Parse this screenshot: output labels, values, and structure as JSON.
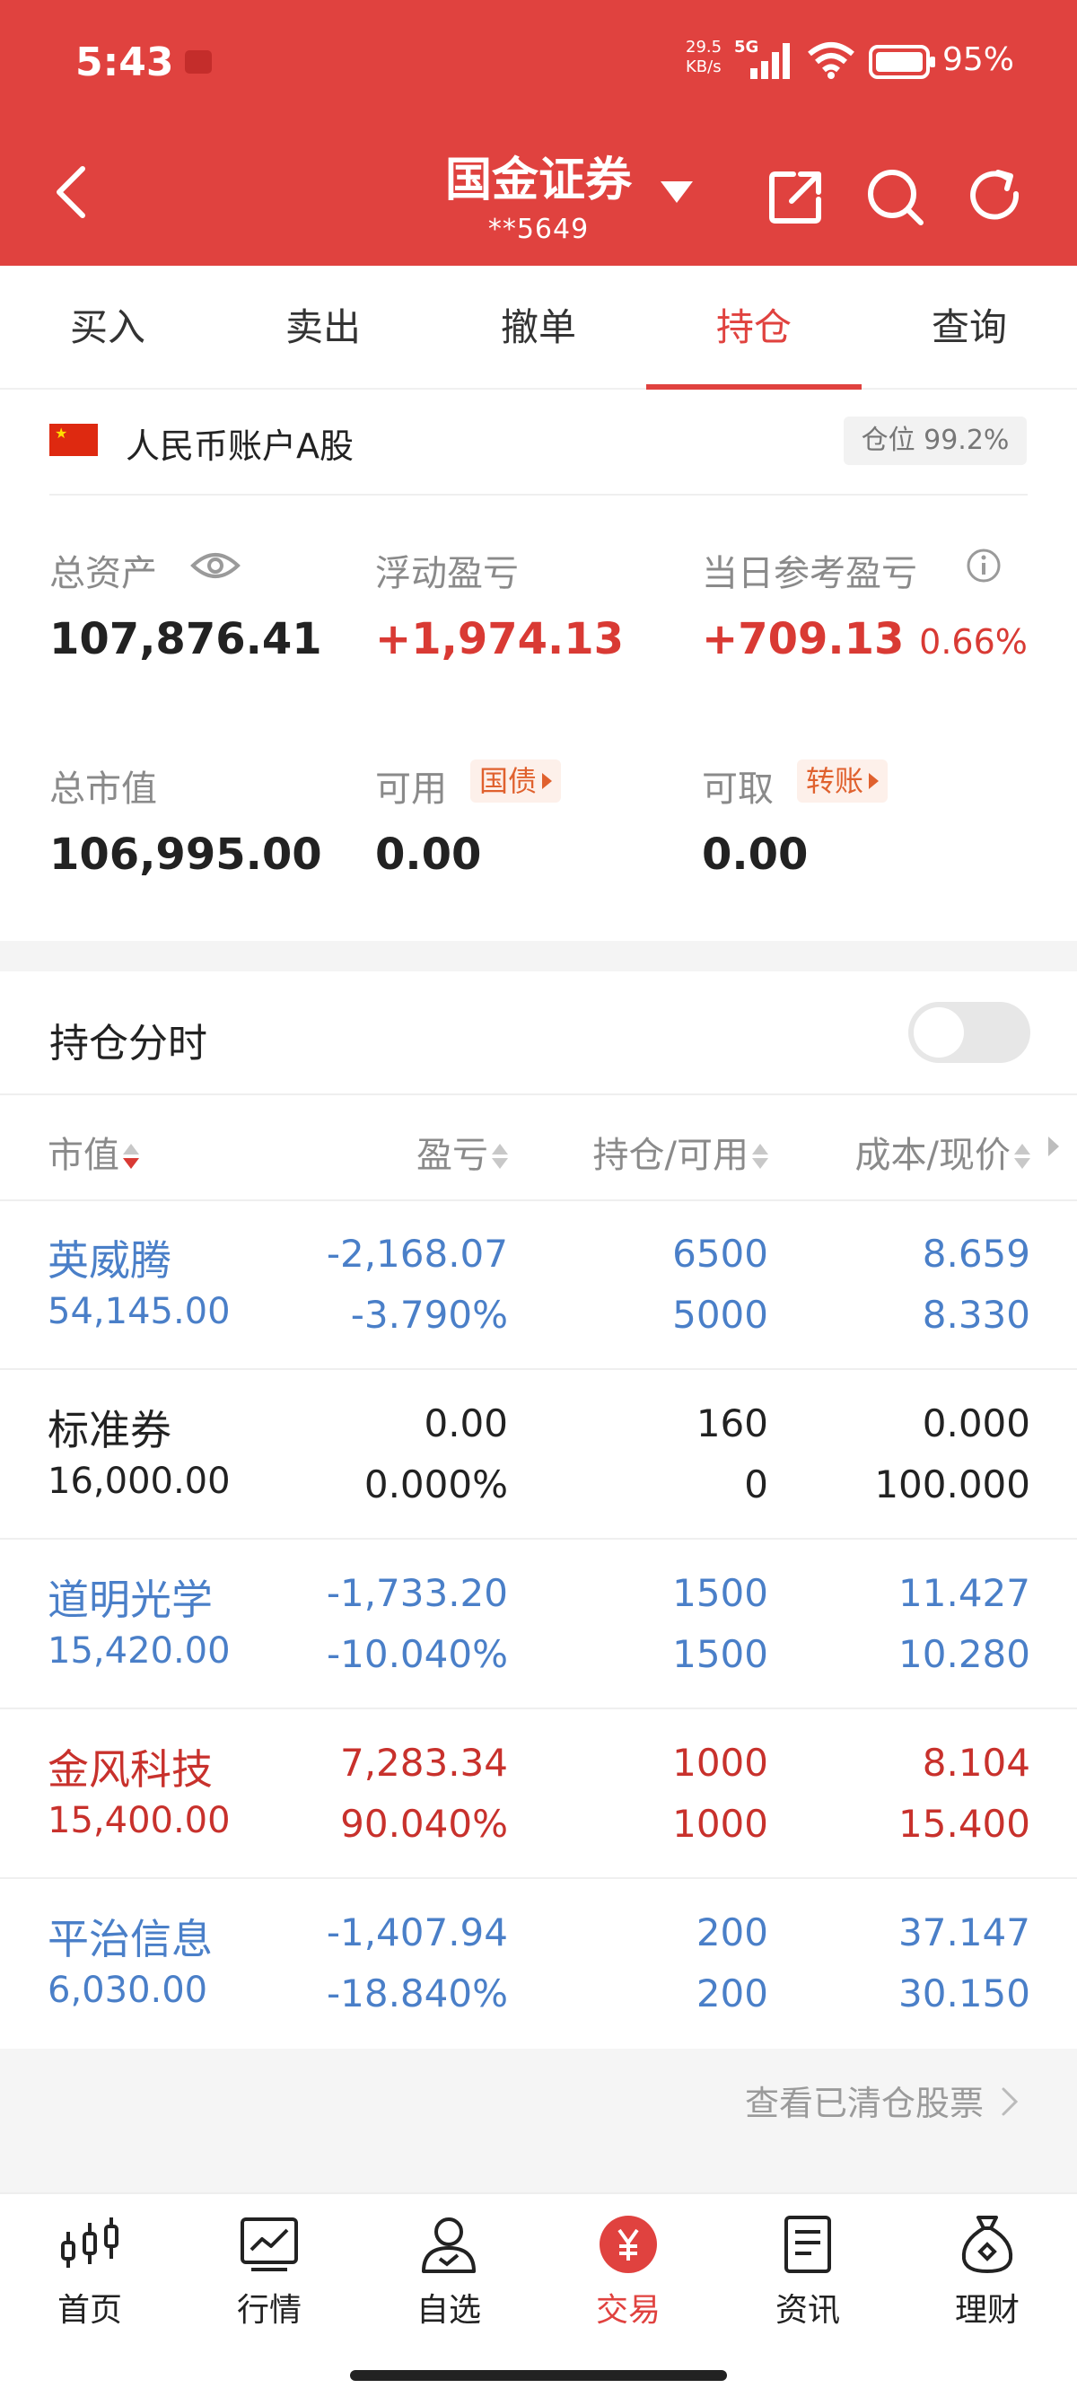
{
  "status": {
    "time": "5:43",
    "net_speed": "29.5\nKB/s",
    "net_speed_top": "29.5",
    "net_speed_bottom": "KB/s",
    "network": "5G",
    "battery": "95%"
  },
  "header": {
    "title": "国金证券",
    "account": "**5649",
    "colors": {
      "brand": "#e0423f"
    }
  },
  "tabs": [
    {
      "label": "买入",
      "active": false
    },
    {
      "label": "卖出",
      "active": false
    },
    {
      "label": "撤单",
      "active": false
    },
    {
      "label": "持仓",
      "active": true
    },
    {
      "label": "查询",
      "active": false
    }
  ],
  "account_summary": {
    "account_name": "人民币账户A股",
    "position_badge": "仓位 99.2%",
    "total_assets_label": "总资产",
    "total_assets": "107,876.41",
    "floating_pl_label": "浮动盈亏",
    "floating_pl": "+1,974.13",
    "daily_pl_label": "当日参考盈亏",
    "daily_pl": "+709.13",
    "daily_pl_pct": "0.66%",
    "market_value_label": "总市值",
    "market_value": "106,995.00",
    "available_label": "可用",
    "available": "0.00",
    "treasury_badge": "国债",
    "withdrawable_label": "可取",
    "withdrawable": "0.00",
    "transfer_badge": "转账"
  },
  "chart_toggle": {
    "label": "持仓分时",
    "enabled": false
  },
  "table": {
    "headers": [
      "市值",
      "盈亏",
      "持仓/可用",
      "成本/现价"
    ],
    "rows": [
      {
        "name": "英威腾",
        "market_value": "54,145.00",
        "pl": "-2,168.07",
        "pl_pct": "-3.790%",
        "qty": "6500",
        "avail": "5000",
        "cost": "8.659",
        "price": "8.330",
        "color": "blue"
      },
      {
        "name": "标准券",
        "market_value": "16,000.00",
        "pl": "0.00",
        "pl_pct": "0.000%",
        "qty": "160",
        "avail": "0",
        "cost": "0.000",
        "price": "100.000",
        "color": "dark"
      },
      {
        "name": "道明光学",
        "market_value": "15,420.00",
        "pl": "-1,733.20",
        "pl_pct": "-10.040%",
        "qty": "1500",
        "avail": "1500",
        "cost": "11.427",
        "price": "10.280",
        "color": "blue"
      },
      {
        "name": "金风科技",
        "market_value": "15,400.00",
        "pl": "7,283.34",
        "pl_pct": "90.040%",
        "qty": "1000",
        "avail": "1000",
        "cost": "8.104",
        "price": "15.400",
        "color": "red"
      },
      {
        "name": "平治信息",
        "market_value": "6,030.00",
        "pl": "-1,407.94",
        "pl_pct": "-18.840%",
        "qty": "200",
        "avail": "200",
        "cost": "37.147",
        "price": "30.150",
        "color": "blue"
      }
    ]
  },
  "cleared_link": "查看已清仓股票",
  "bottom_nav": [
    {
      "label": "首页",
      "icon": "candlestick-icon",
      "active": false
    },
    {
      "label": "行情",
      "icon": "chart-icon",
      "active": false
    },
    {
      "label": "自选",
      "icon": "user-check-icon",
      "active": false
    },
    {
      "label": "交易",
      "icon": "yuan-icon",
      "active": true
    },
    {
      "label": "资讯",
      "icon": "news-icon",
      "active": false
    },
    {
      "label": "理财",
      "icon": "money-bag-icon",
      "active": false
    }
  ]
}
